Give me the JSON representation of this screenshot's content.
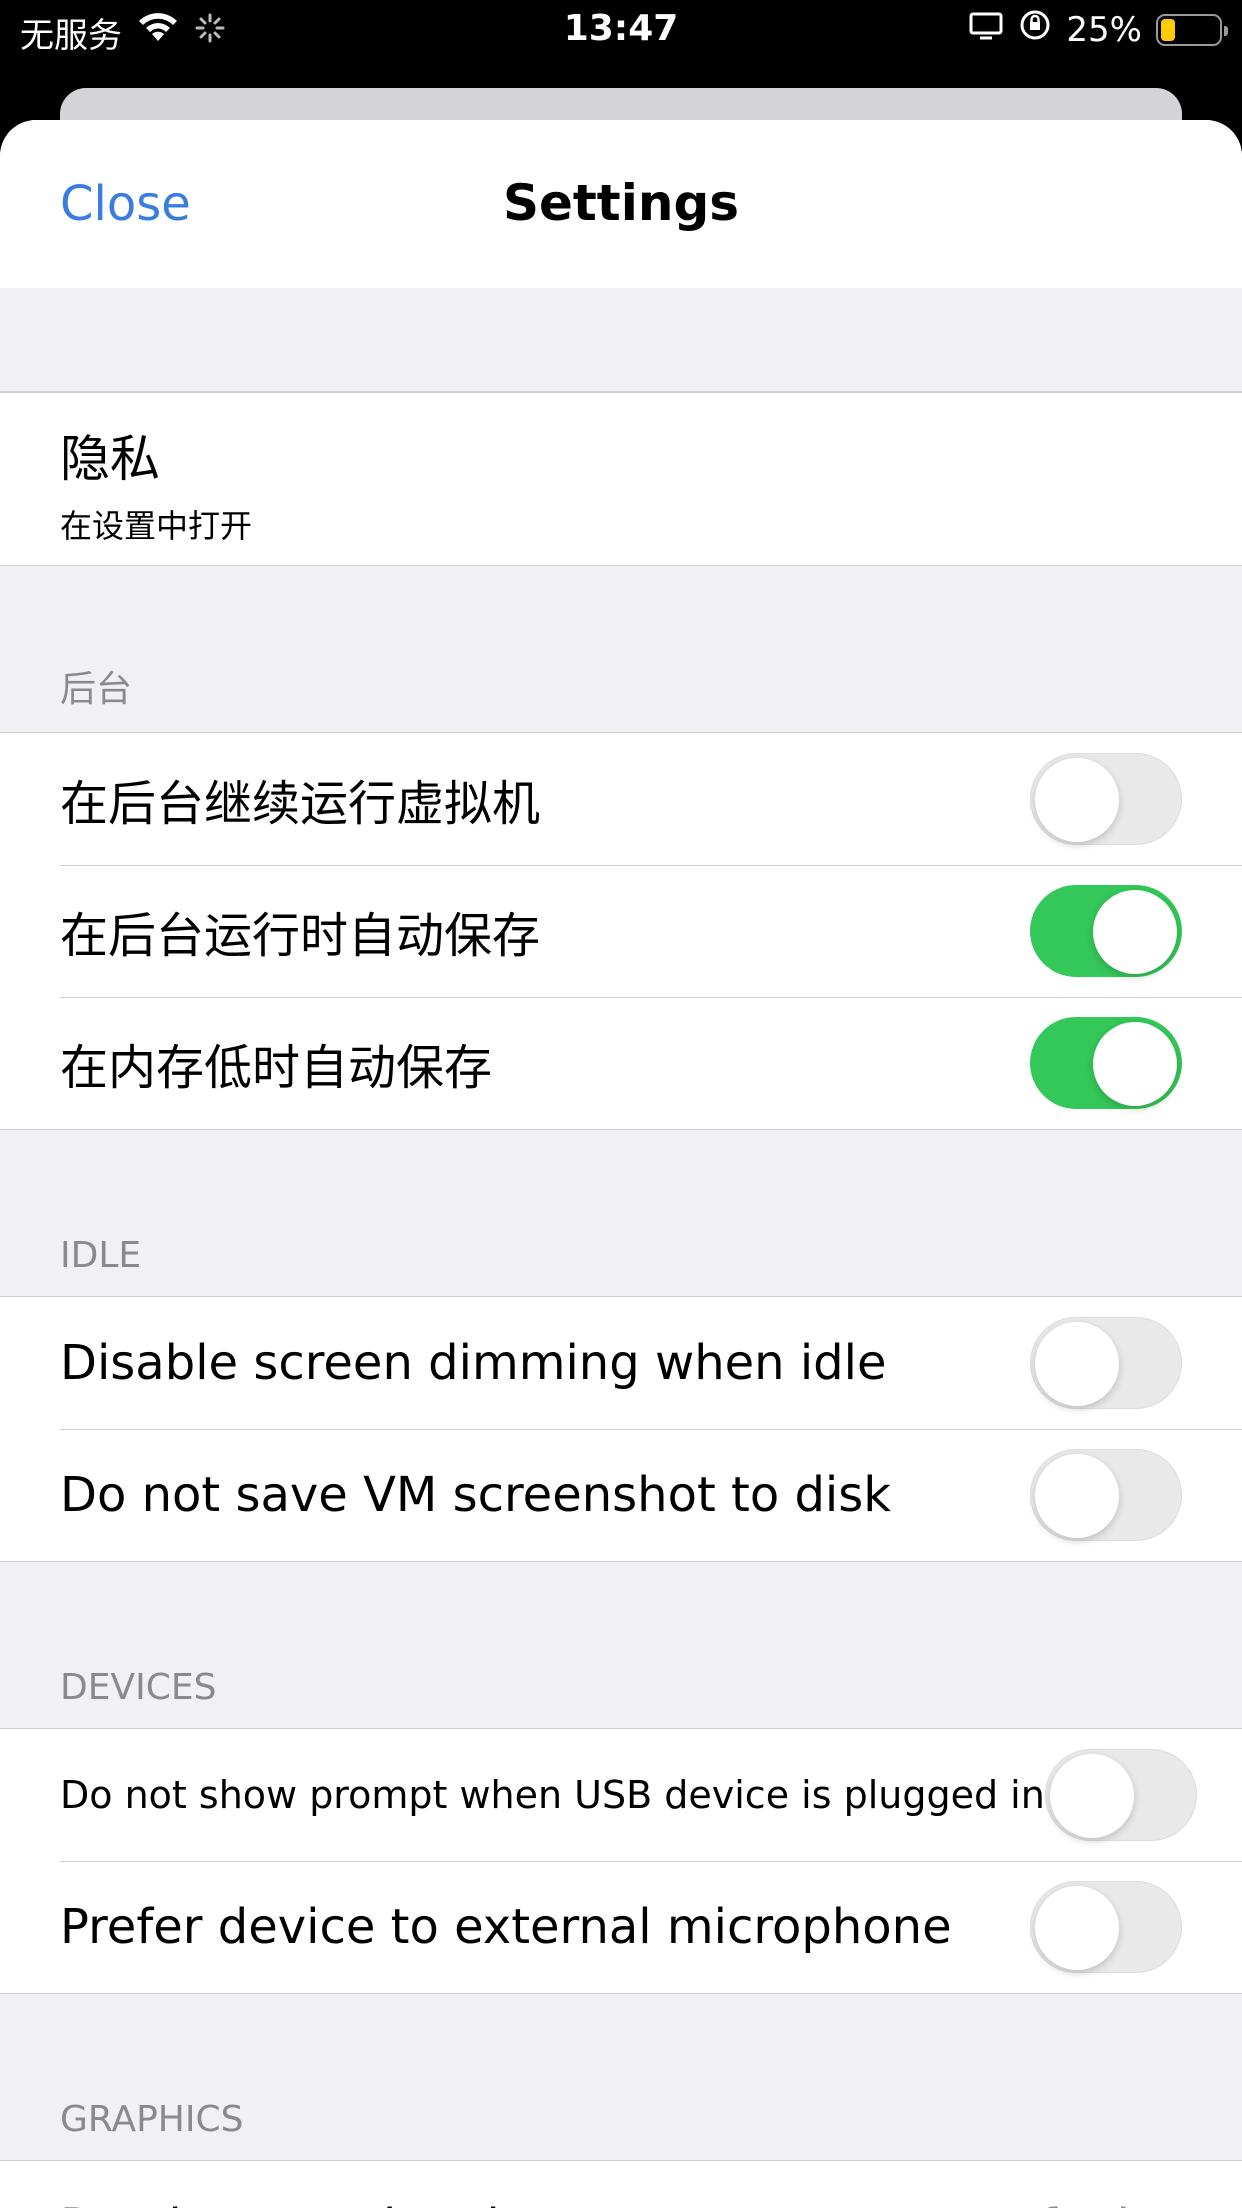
{
  "status_bar": {
    "carrier": "无服务",
    "time": "13:47",
    "battery_percent": "25%",
    "battery_level": 0.25
  },
  "nav": {
    "close_label": "Close",
    "title": "Settings"
  },
  "privacy": {
    "title": "隐私",
    "subtitle": "在设置中打开"
  },
  "sections": {
    "background": {
      "header": "后台",
      "rows": [
        {
          "label": "在后台继续运行虚拟机",
          "on": false
        },
        {
          "label": "在后台运行时自动保存",
          "on": true
        },
        {
          "label": "在内存低时自动保存",
          "on": true
        }
      ]
    },
    "idle": {
      "header": "IDLE",
      "rows": [
        {
          "label": "Disable screen dimming when idle",
          "on": false
        },
        {
          "label": "Do not save VM screenshot to disk",
          "on": false
        }
      ]
    },
    "devices": {
      "header": "DEVICES",
      "rows": [
        {
          "label": "Do not show prompt when USB device is plugged in",
          "on": false
        },
        {
          "label": "Prefer device to external microphone",
          "on": false
        }
      ]
    },
    "graphics": {
      "header": "GRAPHICS",
      "rows": [
        {
          "label": "Renderer Backend",
          "value": "Default"
        }
      ]
    }
  },
  "colors": {
    "accent": "#3a7de0",
    "toggle_on": "#34c759",
    "toggle_off": "#e9e9ea",
    "group_bg": "#f0f0f5",
    "secondary_text": "#8a8a8e"
  }
}
